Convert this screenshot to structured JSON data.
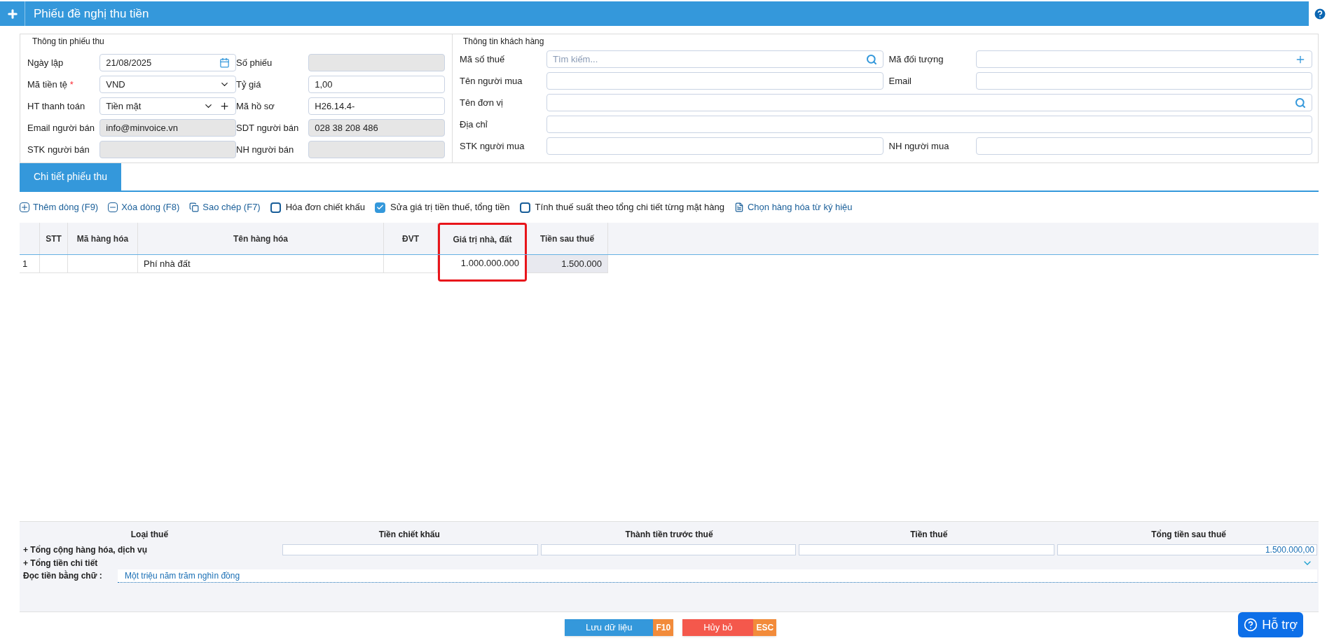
{
  "window": {
    "title": "Phiếu đề nghị thu tiền"
  },
  "receipt_info": {
    "title": "Thông tin phiếu thu",
    "fields": [
      {
        "label": "Ngày lập",
        "value": "21/08/2025",
        "kind": "date",
        "disabled": false
      },
      {
        "label": "Số phiếu",
        "kind": "text",
        "disabled": true
      },
      {
        "label": "Mã tiền tệ",
        "required_mark": "*",
        "value": "VND",
        "kind": "select",
        "disabled": false
      },
      {
        "label": "Tỷ giá",
        "value": "1,00",
        "kind": "text",
        "disabled": false
      },
      {
        "label": "HT thanh toán",
        "value": "Tiền mặt",
        "kind": "select_add",
        "disabled": false
      },
      {
        "label": "Mã hồ sơ",
        "value": "H26.14.4-",
        "kind": "text",
        "disabled": false
      },
      {
        "label": "Email người bán",
        "value": "info@minvoice.vn",
        "kind": "text",
        "disabled": true
      },
      {
        "label": "SDT người bán",
        "value": "028 38 208 486",
        "kind": "text",
        "disabled": true
      },
      {
        "label": "STK người bán",
        "kind": "text",
        "disabled": true
      },
      {
        "label": "NH người bán",
        "kind": "text",
        "disabled": true
      }
    ]
  },
  "customer_info": {
    "title": "Thông tin khách hàng",
    "fields": [
      {
        "label": "Mã số thuế",
        "placeholder": "Tìm kiếm...",
        "kind": "search",
        "wide": false
      },
      {
        "label": "Mã đối tượng",
        "kind": "add",
        "wide": false
      },
      {
        "label": "Tên người mua",
        "kind": "text",
        "wide": false
      },
      {
        "label": "Email",
        "kind": "text",
        "wide": false
      },
      {
        "label": "Tên đơn vị",
        "kind": "search",
        "wide": true
      },
      {
        "label": "Địa chỉ",
        "kind": "text",
        "wide": true
      },
      {
        "label": "STK người mua",
        "kind": "text",
        "wide": false
      },
      {
        "label": "NH người mua",
        "kind": "text",
        "wide": false
      }
    ]
  },
  "tabs": [
    {
      "label": "Chi tiết phiếu thu",
      "selected": true
    }
  ],
  "toolbar": [
    {
      "kind": "add",
      "label": "Thêm dòng (F9)"
    },
    {
      "kind": "remove",
      "label": "Xóa dòng (F8)"
    },
    {
      "kind": "copy",
      "label": "Sao chép (F7)"
    },
    {
      "kind": "checkbox",
      "label": "Hóa đơn chiết khấu",
      "checked": false
    },
    {
      "kind": "checkbox",
      "label": "Sửa giá trị tiền thuế, tổng tiền",
      "checked": true
    },
    {
      "kind": "checkbox",
      "label": "Tính thuế suất theo tổng chi tiết từng mặt hàng",
      "checked": false
    },
    {
      "kind": "pick",
      "label": "Chọn hàng hóa từ ký hiệu"
    }
  ],
  "table": {
    "columns": [
      {
        "label": "STT",
        "highlighted": false
      },
      {
        "label": "Mã hàng hóa",
        "highlighted": false
      },
      {
        "label": "Tên hàng hóa",
        "highlighted": false
      },
      {
        "label": "ĐVT",
        "highlighted": false
      },
      {
        "label": "Giá trị nhà, đất",
        "highlighted": true
      },
      {
        "label": "Tiền sau thuế",
        "highlighted": false
      }
    ],
    "rows": [
      {
        "row_number": "1",
        "cells": [
          "",
          "",
          "Phí nhà đất",
          "",
          "1.000.000.000",
          "1.500.000"
        ]
      }
    ]
  },
  "summary": {
    "columns": [
      "Loại thuế",
      "Tiền chiết khấu",
      "Thành tiền trước thuế",
      "Tiền thuế",
      "Tổng tiền sau thuế"
    ],
    "total_row": {
      "label": "+ Tổng cộng hàng hóa, dịch vụ",
      "after_tax_total": "1.500.000,00"
    },
    "detail_label": "+ Tổng tiền chi tiết",
    "in_words_label": "Đọc tiền bằng chữ :",
    "in_words": "Một triệu năm trăm nghìn đồng"
  },
  "buttons": [
    {
      "kind": "save",
      "label": "Lưu dữ liệu",
      "shortcut": "F10"
    },
    {
      "kind": "cancel",
      "label": "Hủy bỏ",
      "shortcut": "ESC"
    }
  ],
  "help_button": {
    "label": "Hỗ trợ"
  }
}
